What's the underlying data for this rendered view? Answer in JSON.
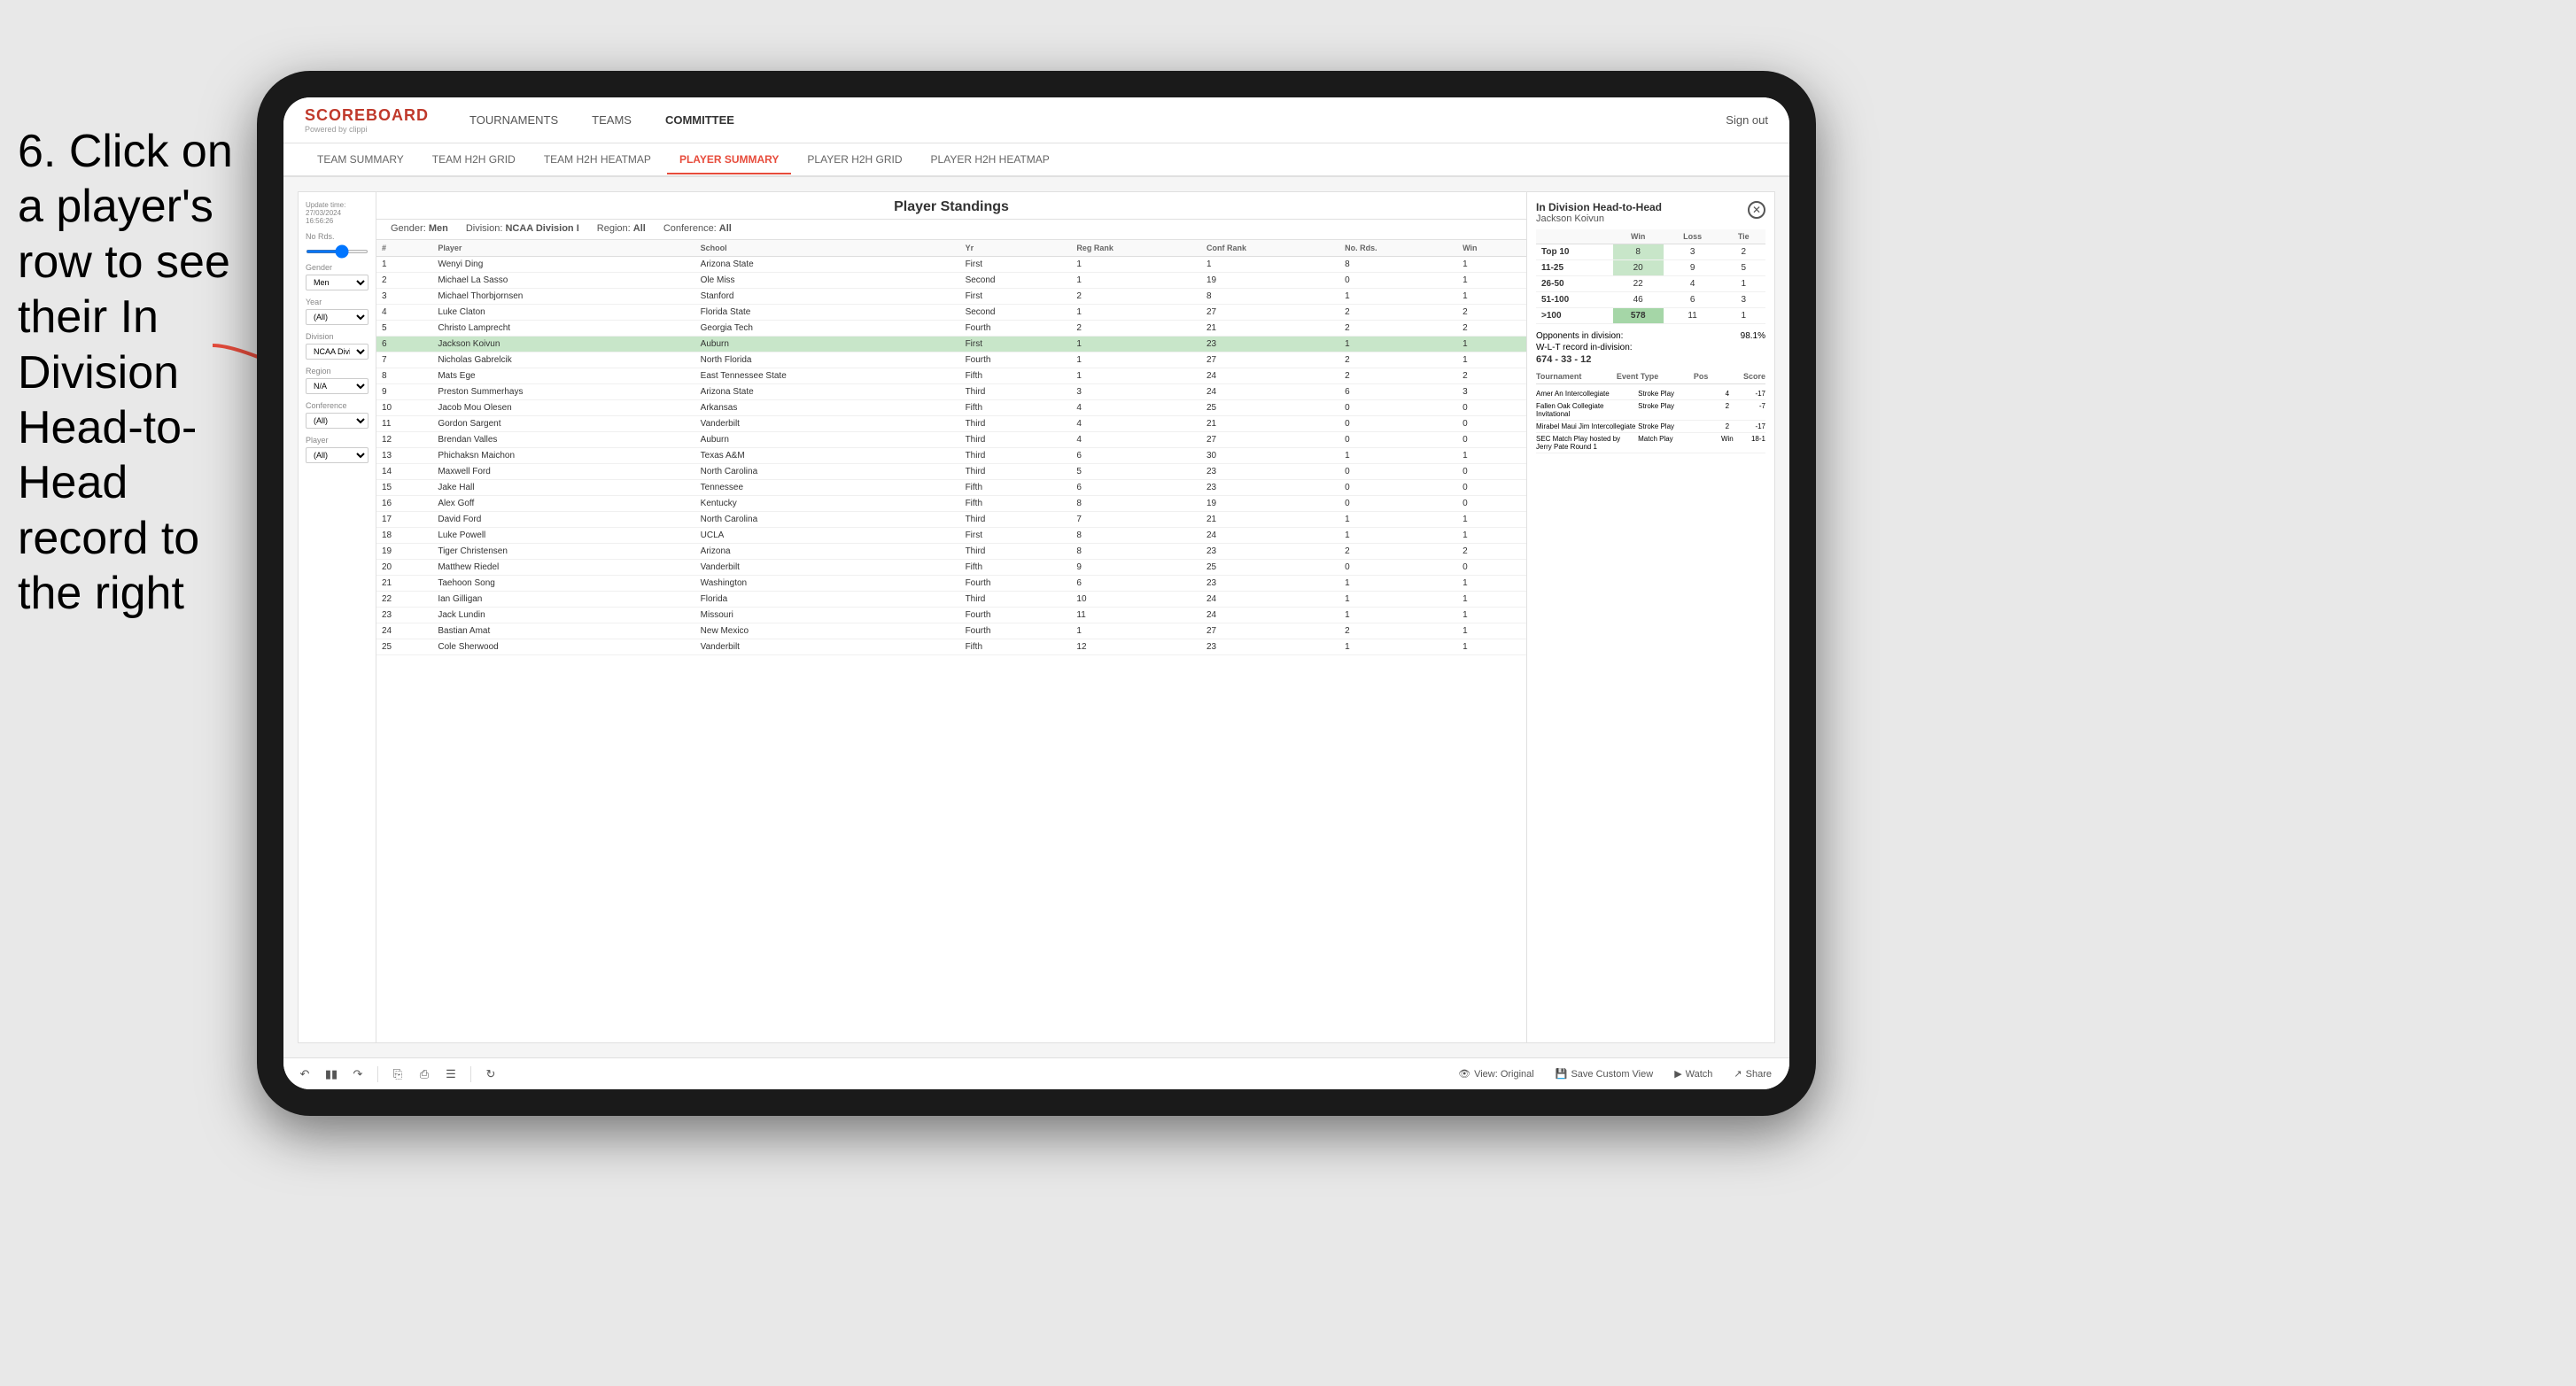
{
  "instruction": {
    "text": "6. Click on a player's row to see their In Division Head-to-Head record to the right"
  },
  "nav": {
    "logo": "SCOREBOARD",
    "powered_by": "Powered by clippi",
    "items": [
      "TOURNAMENTS",
      "TEAMS",
      "COMMITTEE"
    ],
    "sign_out": "Sign out"
  },
  "sub_nav": {
    "items": [
      "TEAM SUMMARY",
      "TEAM H2H GRID",
      "TEAM H2H HEATMAP",
      "PLAYER SUMMARY",
      "PLAYER H2H GRID",
      "PLAYER H2H HEATMAP"
    ],
    "active": "PLAYER SUMMARY"
  },
  "standings": {
    "title": "Player Standings",
    "update_time": "Update time: 27/03/2024 16:56:26",
    "filters": {
      "gender": "Men",
      "division": "NCAA Division I",
      "region": "All",
      "conference": "All"
    }
  },
  "filters_sidebar": {
    "no_rds_label": "No Rds.",
    "gender_label": "Gender",
    "gender_value": "Men",
    "year_label": "Year",
    "year_value": "(All)",
    "division_label": "Division",
    "division_value": "NCAA Division I",
    "region_label": "Region",
    "region_value": "N/A",
    "conference_label": "Conference",
    "conference_value": "(All)",
    "player_label": "Player",
    "player_value": "(All)"
  },
  "table_columns": [
    "#",
    "Player",
    "School",
    "Yr",
    "Reg Rank",
    "Conf Rank",
    "No. Rds.",
    "Win"
  ],
  "table_rows": [
    {
      "num": "1",
      "player": "Wenyi Ding",
      "school": "Arizona State",
      "yr": "First",
      "reg_rank": "1",
      "conf_rank": "1",
      "no_rds": "8",
      "win": "1"
    },
    {
      "num": "2",
      "player": "Michael La Sasso",
      "school": "Ole Miss",
      "yr": "Second",
      "reg_rank": "1",
      "conf_rank": "19",
      "no_rds": "0",
      "win": "1"
    },
    {
      "num": "3",
      "player": "Michael Thorbjornsen",
      "school": "Stanford",
      "yr": "First",
      "reg_rank": "2",
      "conf_rank": "8",
      "no_rds": "1",
      "win": "1"
    },
    {
      "num": "4",
      "player": "Luke Claton",
      "school": "Florida State",
      "yr": "Second",
      "reg_rank": "1",
      "conf_rank": "27",
      "no_rds": "2",
      "win": "2"
    },
    {
      "num": "5",
      "player": "Christo Lamprecht",
      "school": "Georgia Tech",
      "yr": "Fourth",
      "reg_rank": "2",
      "conf_rank": "21",
      "no_rds": "2",
      "win": "2"
    },
    {
      "num": "6",
      "player": "Jackson Koivun",
      "school": "Auburn",
      "yr": "First",
      "reg_rank": "1",
      "conf_rank": "23",
      "no_rds": "1",
      "win": "1",
      "selected": true
    },
    {
      "num": "7",
      "player": "Nicholas Gabrelcik",
      "school": "North Florida",
      "yr": "Fourth",
      "reg_rank": "1",
      "conf_rank": "27",
      "no_rds": "2",
      "win": "1"
    },
    {
      "num": "8",
      "player": "Mats Ege",
      "school": "East Tennessee State",
      "yr": "Fifth",
      "reg_rank": "1",
      "conf_rank": "24",
      "no_rds": "2",
      "win": "2"
    },
    {
      "num": "9",
      "player": "Preston Summerhays",
      "school": "Arizona State",
      "yr": "Third",
      "reg_rank": "3",
      "conf_rank": "24",
      "no_rds": "6",
      "win": "3"
    },
    {
      "num": "10",
      "player": "Jacob Mou Olesen",
      "school": "Arkansas",
      "yr": "Fifth",
      "reg_rank": "4",
      "conf_rank": "25",
      "no_rds": "0",
      "win": "0"
    },
    {
      "num": "11",
      "player": "Gordon Sargent",
      "school": "Vanderbilt",
      "yr": "Third",
      "reg_rank": "4",
      "conf_rank": "21",
      "no_rds": "0",
      "win": "0"
    },
    {
      "num": "12",
      "player": "Brendan Valles",
      "school": "Auburn",
      "yr": "Third",
      "reg_rank": "4",
      "conf_rank": "27",
      "no_rds": "0",
      "win": "0"
    },
    {
      "num": "13",
      "player": "Phichaksn Maichon",
      "school": "Texas A&M",
      "yr": "Third",
      "reg_rank": "6",
      "conf_rank": "30",
      "no_rds": "1",
      "win": "1"
    },
    {
      "num": "14",
      "player": "Maxwell Ford",
      "school": "North Carolina",
      "yr": "Third",
      "reg_rank": "5",
      "conf_rank": "23",
      "no_rds": "0",
      "win": "0"
    },
    {
      "num": "15",
      "player": "Jake Hall",
      "school": "Tennessee",
      "yr": "Fifth",
      "reg_rank": "6",
      "conf_rank": "23",
      "no_rds": "0",
      "win": "0"
    },
    {
      "num": "16",
      "player": "Alex Goff",
      "school": "Kentucky",
      "yr": "Fifth",
      "reg_rank": "8",
      "conf_rank": "19",
      "no_rds": "0",
      "win": "0"
    },
    {
      "num": "17",
      "player": "David Ford",
      "school": "North Carolina",
      "yr": "Third",
      "reg_rank": "7",
      "conf_rank": "21",
      "no_rds": "1",
      "win": "1"
    },
    {
      "num": "18",
      "player": "Luke Powell",
      "school": "UCLA",
      "yr": "First",
      "reg_rank": "8",
      "conf_rank": "24",
      "no_rds": "1",
      "win": "1"
    },
    {
      "num": "19",
      "player": "Tiger Christensen",
      "school": "Arizona",
      "yr": "Third",
      "reg_rank": "8",
      "conf_rank": "23",
      "no_rds": "2",
      "win": "2"
    },
    {
      "num": "20",
      "player": "Matthew Riedel",
      "school": "Vanderbilt",
      "yr": "Fifth",
      "reg_rank": "9",
      "conf_rank": "25",
      "no_rds": "0",
      "win": "0"
    },
    {
      "num": "21",
      "player": "Taehoon Song",
      "school": "Washington",
      "yr": "Fourth",
      "reg_rank": "6",
      "conf_rank": "23",
      "no_rds": "1",
      "win": "1"
    },
    {
      "num": "22",
      "player": "Ian Gilligan",
      "school": "Florida",
      "yr": "Third",
      "reg_rank": "10",
      "conf_rank": "24",
      "no_rds": "1",
      "win": "1"
    },
    {
      "num": "23",
      "player": "Jack Lundin",
      "school": "Missouri",
      "yr": "Fourth",
      "reg_rank": "11",
      "conf_rank": "24",
      "no_rds": "1",
      "win": "1"
    },
    {
      "num": "24",
      "player": "Bastian Amat",
      "school": "New Mexico",
      "yr": "Fourth",
      "reg_rank": "1",
      "conf_rank": "27",
      "no_rds": "2",
      "win": "1"
    },
    {
      "num": "25",
      "player": "Cole Sherwood",
      "school": "Vanderbilt",
      "yr": "Fifth",
      "reg_rank": "12",
      "conf_rank": "23",
      "no_rds": "1",
      "win": "1"
    }
  ],
  "h2h": {
    "title": "In Division Head-to-Head",
    "player_name": "Jackson Koivun",
    "columns": [
      "",
      "Win",
      "Loss",
      "Tie"
    ],
    "rows": [
      {
        "rank": "Top 10",
        "win": "8",
        "loss": "3",
        "tie": "2",
        "win_highlight": true
      },
      {
        "rank": "11-25",
        "win": "20",
        "loss": "9",
        "tie": "5",
        "win_highlight": true
      },
      {
        "rank": "26-50",
        "win": "22",
        "loss": "4",
        "tie": "1"
      },
      {
        "rank": "51-100",
        "win": "46",
        "loss": "6",
        "tie": "3"
      },
      {
        "rank": ">100",
        "win": "578",
        "loss": "11",
        "tie": "1",
        "win_dark": true
      }
    ],
    "opponents_pct_label": "Opponents in division:",
    "opponents_pct": "98.1%",
    "record_label": "W-L-T record in-division:",
    "record": "674 - 33 - 12",
    "tournaments": {
      "columns": [
        "Tournament",
        "Event Type",
        "Pos",
        "Score"
      ],
      "rows": [
        {
          "tournament": "Amer An Intercollegiate",
          "event_type": "Stroke Play",
          "pos": "4",
          "score": "-17"
        },
        {
          "tournament": "Fallen Oak Collegiate Invitational",
          "event_type": "Stroke Play",
          "pos": "2",
          "score": "-7"
        },
        {
          "tournament": "Mirabel Maui Jim Intercollegiate",
          "event_type": "Stroke Play",
          "pos": "2",
          "score": "-17"
        },
        {
          "tournament": "SEC Match Play hosted by Jerry Pate Round 1",
          "event_type": "Match Play",
          "pos": "Win",
          "score": "18-1"
        }
      ]
    }
  },
  "toolbar": {
    "view_original": "View: Original",
    "save_custom": "Save Custom View",
    "watch": "Watch",
    "share": "Share"
  },
  "colors": {
    "accent_red": "#e74c3c",
    "green_dark": "#66bb6a",
    "green_medium": "#a5d6a7",
    "green_light": "#c8e6c9",
    "selected_row": "#c8e6c9"
  }
}
